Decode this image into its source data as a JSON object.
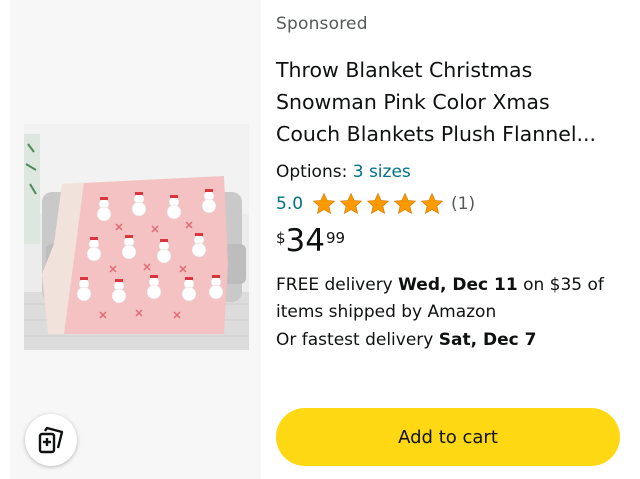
{
  "listing": {
    "sponsored_label": "Sponsored",
    "title_line1": "Throw Blanket Christmas",
    "title_line2": "Snowman Pink Color Xmas",
    "title_line3": "Couch Blankets Plush Flannel...",
    "options_label": "Options:",
    "options_link": "3 sizes",
    "rating_value": "5.0",
    "rating_stars": 5,
    "rating_count": "(1)",
    "price_currency": "$",
    "price_whole": "34",
    "price_fraction": "99",
    "delivery_prefix": "FREE delivery ",
    "delivery_date": "Wed, Dec 11",
    "delivery_suffix": " on $35 of items shipped by Amazon",
    "fastest_prefix": "Or fastest delivery ",
    "fastest_date": "Sat, Dec 7",
    "add_to_cart_label": "Add to cart"
  },
  "icons": {
    "compare": "compare-cards-icon",
    "star": "star-icon"
  },
  "colors": {
    "link": "#007185",
    "star": "#ff9900",
    "button": "#ffd814",
    "muted": "#565959"
  }
}
